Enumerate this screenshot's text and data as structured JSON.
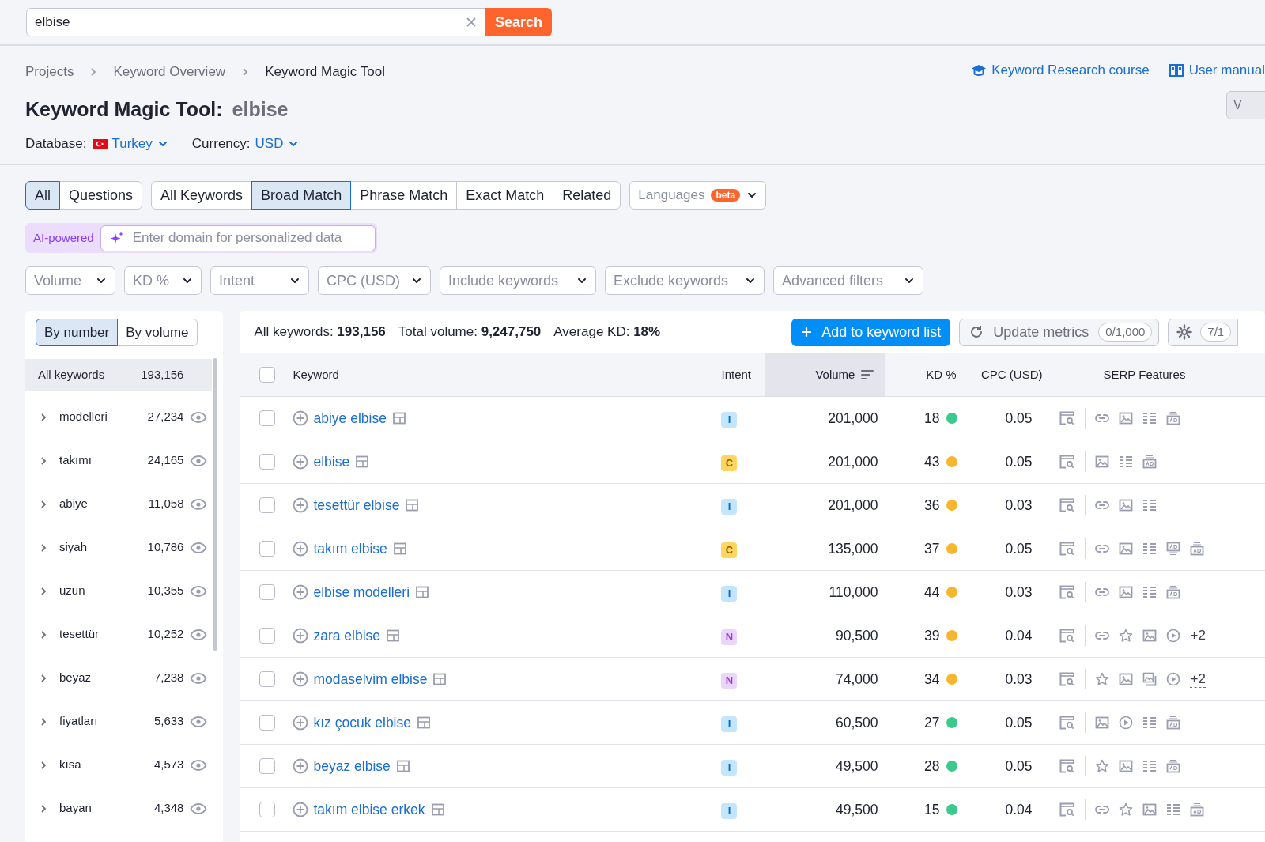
{
  "search": {
    "value": "elbise",
    "button": "Search"
  },
  "breadcrumbs": [
    {
      "label": "Projects",
      "current": false
    },
    {
      "label": "Keyword Overview",
      "current": false
    },
    {
      "label": "Keyword Magic Tool",
      "current": true
    }
  ],
  "header_links": [
    {
      "label": "Keyword Research course",
      "kind": "course"
    },
    {
      "label": "User manual",
      "kind": "manual"
    }
  ],
  "edge_button": "V",
  "title": {
    "main": "Keyword Magic Tool:",
    "query": "elbise"
  },
  "database": {
    "label": "Database:",
    "value": "Turkey"
  },
  "currency": {
    "label": "Currency:",
    "value": "USD"
  },
  "question_tabs": [
    {
      "label": "All",
      "selected": true
    },
    {
      "label": "Questions",
      "selected": false
    }
  ],
  "match_tabs": [
    {
      "label": "All Keywords",
      "selected": false
    },
    {
      "label": "Broad Match",
      "selected": true
    },
    {
      "label": "Phrase Match",
      "selected": false
    },
    {
      "label": "Exact Match",
      "selected": false
    },
    {
      "label": "Related",
      "selected": false
    }
  ],
  "languages": {
    "label": "Languages",
    "badge": "beta"
  },
  "ai": {
    "badge": "AI-powered",
    "placeholder": "Enter domain for personalized data"
  },
  "filters": [
    "Volume",
    "KD %",
    "Intent",
    "CPC (USD)",
    "Include keywords",
    "Exclude keywords",
    "Advanced filters"
  ],
  "group_toggle": [
    {
      "label": "By number",
      "selected": true
    },
    {
      "label": "By volume",
      "selected": false
    }
  ],
  "groups": {
    "all": {
      "label": "All keywords",
      "count": "193,156",
      "selected": true
    },
    "items": [
      {
        "label": "modelleri",
        "count": "27,234",
        "selected": false
      },
      {
        "label": "takımı",
        "count": "24,165",
        "selected": false
      },
      {
        "label": "abiye",
        "count": "11,058",
        "selected": false
      },
      {
        "label": "siyah",
        "count": "10,786",
        "selected": false
      },
      {
        "label": "uzun",
        "count": "10,355",
        "selected": false
      },
      {
        "label": "tesettür",
        "count": "10,252",
        "selected": false
      },
      {
        "label": "beyaz",
        "count": "7,238",
        "selected": false
      },
      {
        "label": "fiyatları",
        "count": "5,633",
        "selected": false
      },
      {
        "label": "kısa",
        "count": "4,573",
        "selected": false
      },
      {
        "label": "bayan",
        "count": "4,348",
        "selected": false
      }
    ]
  },
  "summary": [
    "All keywords: **193,156**",
    "Total volume: **9,247,750**",
    "Average KD: **18%**"
  ],
  "actions": {
    "add": "Add to keyword list",
    "update": "Update metrics",
    "update_count": "0/1,000",
    "settings_count": "7/1"
  },
  "table": {
    "header_checked": false,
    "columns": [
      {
        "label": "Keyword",
        "sorted": false
      },
      {
        "label": "Intent",
        "sorted": false
      },
      {
        "label": "Volume",
        "sorted": true
      },
      {
        "label": "KD %",
        "sorted": false
      },
      {
        "label": "CPC (USD)",
        "sorted": false
      },
      {
        "label": "SERP Features",
        "sorted": false
      }
    ],
    "rows": [
      {
        "checked": false,
        "keyword": "abiye elbise",
        "intent": {
          "kind": "informational",
          "label": "I"
        },
        "volume": "201,000",
        "kd": "18",
        "color": "#3cc98c",
        "cpc": "0.05",
        "serp": [
          {
            "kind": "link"
          },
          {
            "kind": "image"
          },
          {
            "kind": "list"
          },
          {
            "kind": "ad_bottom"
          }
        ]
      },
      {
        "checked": false,
        "keyword": "elbise",
        "intent": {
          "kind": "commercial",
          "label": "C"
        },
        "volume": "201,000",
        "kd": "43",
        "color": "#f7b62f",
        "cpc": "0.05",
        "serp": [
          {
            "kind": "image"
          },
          {
            "kind": "list"
          },
          {
            "kind": "ad_bottom"
          }
        ]
      },
      {
        "checked": false,
        "keyword": "tesettür elbise",
        "intent": {
          "kind": "informational",
          "label": "I"
        },
        "volume": "201,000",
        "kd": "36",
        "color": "#f7b62f",
        "cpc": "0.03",
        "serp": [
          {
            "kind": "link"
          },
          {
            "kind": "image"
          },
          {
            "kind": "list"
          }
        ]
      },
      {
        "checked": false,
        "keyword": "takım elbise",
        "intent": {
          "kind": "commercial",
          "label": "C"
        },
        "volume": "135,000",
        "kd": "37",
        "color": "#f7b62f",
        "cpc": "0.05",
        "serp": [
          {
            "kind": "link"
          },
          {
            "kind": "image"
          },
          {
            "kind": "list"
          },
          {
            "kind": "ad_top"
          },
          {
            "kind": "ad_bottom"
          }
        ]
      },
      {
        "checked": false,
        "keyword": "elbise modelleri",
        "intent": {
          "kind": "informational",
          "label": "I"
        },
        "volume": "110,000",
        "kd": "44",
        "color": "#f7b62f",
        "cpc": "0.03",
        "serp": [
          {
            "kind": "link"
          },
          {
            "kind": "image"
          },
          {
            "kind": "list"
          },
          {
            "kind": "ad_bottom"
          }
        ]
      },
      {
        "checked": false,
        "keyword": "zara elbise",
        "intent": {
          "kind": "navigational",
          "label": "N"
        },
        "volume": "90,500",
        "kd": "39",
        "color": "#f7b62f",
        "cpc": "0.04",
        "serp": [
          {
            "kind": "link"
          },
          {
            "kind": "star"
          },
          {
            "kind": "image"
          },
          {
            "kind": "video"
          }
        ],
        "more": "+2"
      },
      {
        "checked": false,
        "keyword": "modaselvim elbise",
        "intent": {
          "kind": "navigational",
          "label": "N"
        },
        "volume": "74,000",
        "kd": "34",
        "color": "#f7b62f",
        "cpc": "0.03",
        "serp": [
          {
            "kind": "star"
          },
          {
            "kind": "image"
          },
          {
            "kind": "image_pack"
          },
          {
            "kind": "video"
          }
        ],
        "more": "+2"
      },
      {
        "checked": false,
        "keyword": "kız çocuk elbise",
        "intent": {
          "kind": "informational",
          "label": "I"
        },
        "volume": "60,500",
        "kd": "27",
        "color": "#3cc98c",
        "cpc": "0.05",
        "serp": [
          {
            "kind": "image"
          },
          {
            "kind": "video"
          },
          {
            "kind": "list"
          },
          {
            "kind": "ad_bottom"
          }
        ]
      },
      {
        "checked": false,
        "keyword": "beyaz elbise",
        "intent": {
          "kind": "informational",
          "label": "I"
        },
        "volume": "49,500",
        "kd": "28",
        "color": "#3cc98c",
        "cpc": "0.05",
        "serp": [
          {
            "kind": "star"
          },
          {
            "kind": "image"
          },
          {
            "kind": "list"
          },
          {
            "kind": "ad_bottom"
          }
        ]
      },
      {
        "checked": false,
        "keyword": "takım elbise erkek",
        "intent": {
          "kind": "informational",
          "label": "I"
        },
        "volume": "49,500",
        "kd": "15",
        "color": "#3cc98c",
        "cpc": "0.04",
        "serp": [
          {
            "kind": "link"
          },
          {
            "kind": "star"
          },
          {
            "kind": "image"
          },
          {
            "kind": "list"
          },
          {
            "kind": "ad_bottom"
          }
        ]
      }
    ]
  }
}
